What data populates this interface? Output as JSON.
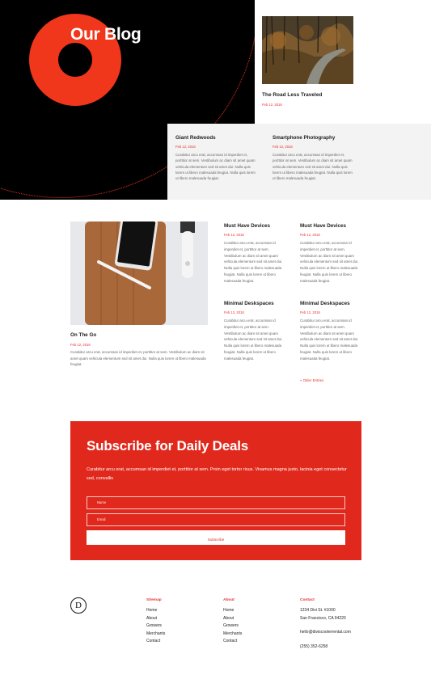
{
  "hero": {
    "title": "Our Blog",
    "featured": {
      "title": "The Road Less Traveled",
      "date": "Feb 12, 2018"
    },
    "posts": [
      {
        "title": "Giant Redwoods",
        "date": "Feb 12, 2018",
        "excerpt": "Curabitur arcu erat, accumsan id imperdiet et, porttitor at sem. Vestibulum ac diam sit amet quam vehicula elementum sed sit amet dui. Nulla quis lorem ut libero malesuada feugiat. Nulla quis lorem ut libero malesuada feugiat."
      },
      {
        "title": "Smartphone Photography",
        "date": "Feb 12, 2018",
        "excerpt": "Curabitur arcu erat, accumsan id imperdiet et, porttitor at sem. Vestibulum ac diam sit amet quam vehicula elementum sed sit amet dui. Nulla quis lorem ut libero malesuada feugiat. Nulla quis lorem ut libero malesuada feugiat."
      }
    ]
  },
  "blog": {
    "featured": {
      "title": "On The Go",
      "date": "Feb 12, 2018",
      "excerpt": "Curabitur arcu erat, accumsan id imperdiet et, porttitor at sem. Vestibulum ac diam sit amet quam vehicula elementum sed sit amet dui. Nulla quis lorem ut libero malesuada feugiat."
    },
    "posts": [
      {
        "title": "Must Have Devices",
        "date": "Feb 12, 2018",
        "excerpt": "Curabitur arcu erat, accumsan id imperdiet et, porttitor at sem. Vestibulum ac diam sit amet quam vehicula elementum sed sit amet dui. Nulla quis lorem ut libero malesuada feugiat. Nulla quis lorem ut libero malesuada feugiat."
      },
      {
        "title": "Must Have Devices",
        "date": "Feb 12, 2018",
        "excerpt": "Curabitur arcu erat, accumsan id imperdiet et, porttitor at sem. Vestibulum ac diam sit amet quam vehicula elementum sed sit amet dui. Nulla quis lorem ut libero malesuada feugiat. Nulla quis lorem ut libero malesuada feugiat."
      },
      {
        "title": "Minimal Deskspaces",
        "date": "Feb 12, 2018",
        "excerpt": "Curabitur arcu erat, accumsan id imperdiet et, porttitor at sem. Vestibulum ac diam sit amet quam vehicula elementum sed sit amet dui. Nulla quis lorem ut libero malesuada feugiat. Nulla quis lorem ut libero malesuada feugiat."
      },
      {
        "title": "Minimal Deskspaces",
        "date": "Feb 12, 2018",
        "excerpt": "Curabitur arcu erat, accumsan id imperdiet et, porttitor at sem. Vestibulum ac diam sit amet quam vehicula elementum sed sit amet dui. Nulla quis lorem ut libero malesuada feugiat. Nulla quis lorem ut libero malesuada feugiat."
      }
    ],
    "older_entries": "« Older Entries"
  },
  "subscribe": {
    "title": "Subscribe for Daily Deals",
    "text": "Curabitur arcu erat, accumsan id imperdiet et, porttitor at sem. Proin eget tortor risus. Vivamus magna justo, lacinia eget consectetur sed, convallis",
    "name_placeholder": "Name",
    "email_placeholder": "Email",
    "button_label": "Subscribe",
    "accent_color": "#e0291c"
  },
  "footer": {
    "logo_letter": "D",
    "sitemap": {
      "heading": "Sitemap",
      "links": [
        "Home",
        "About",
        "Growers",
        "Merchants",
        "Contact"
      ]
    },
    "about": {
      "heading": "About",
      "links": [
        "Home",
        "About",
        "Growers",
        "Merchants",
        "Contact"
      ]
    },
    "contact": {
      "heading": "Contact",
      "address1": "1234 Divi St. #1000",
      "address2": "San Francisco, CA 94220",
      "email": "hello@diviscooterrental.com",
      "phone": "(255) 352-6258"
    }
  }
}
